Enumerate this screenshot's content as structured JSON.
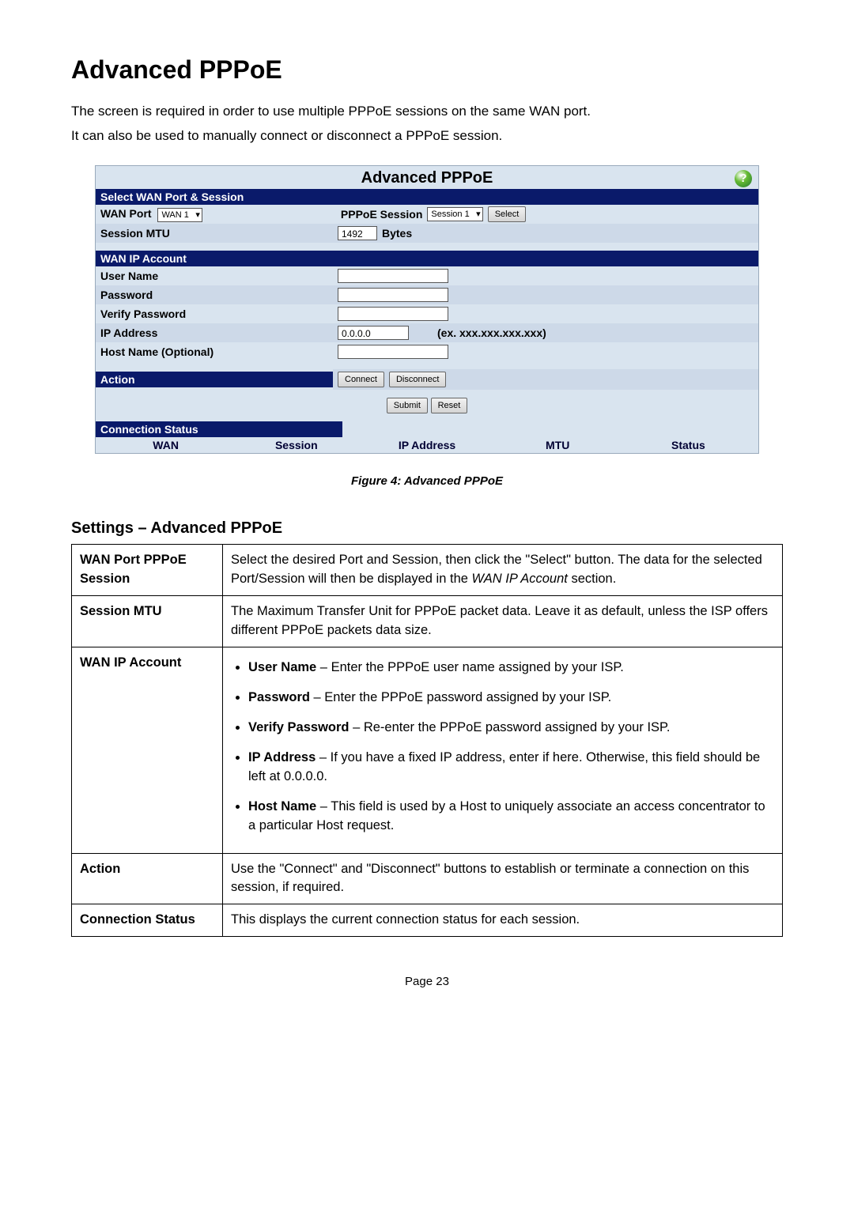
{
  "heading": "Advanced PPPoE",
  "intro_line_1": "The screen is required in order to use multiple PPPoE sessions on the same WAN port.",
  "intro_line_2": "It can also be used to manually connect or disconnect a PPPoE session.",
  "screenshot": {
    "title": "Advanced PPPoE",
    "help_glyph": "?",
    "section_select": "Select WAN Port & Session",
    "row_wan_port_label": "WAN Port",
    "row_wan_port_select": "WAN 1",
    "row_pppoe_session_label": "PPPoE Session",
    "row_pppoe_session_select": "Session 1",
    "row_select_button": "Select",
    "row_session_mtu_label": "Session MTU",
    "row_session_mtu_value": "1492",
    "row_session_mtu_unit": "Bytes",
    "section_wan_ip": "WAN IP Account",
    "row_username_label": "User Name",
    "row_password_label": "Password",
    "row_verify_label": "Verify Password",
    "row_ip_label": "IP Address",
    "row_ip_value": "0.0.0.0",
    "row_ip_hint": "(ex. xxx.xxx.xxx.xxx)",
    "row_hostname_label": "Host Name (Optional)",
    "section_action": "Action",
    "btn_connect": "Connect",
    "btn_disconnect": "Disconnect",
    "btn_submit": "Submit",
    "btn_reset": "Reset",
    "section_conn_status": "Connection Status",
    "col_wan": "WAN",
    "col_session": "Session",
    "col_ip": "IP Address",
    "col_mtu": "MTU",
    "col_status": "Status"
  },
  "figure_caption": "Figure 4: Advanced PPPoE",
  "settings_heading": "Settings – Advanced PPPoE",
  "settings": {
    "row1_label": "WAN Port PPPoE Session",
    "row1_text": "Select the desired Port and Session, then click the \"Select\" button. The data for the selected Port/Session will then be displayed in the WAN IP Account section.",
    "row2_label": "Session MTU",
    "row2_text": "The Maximum Transfer Unit for PPPoE packet data. Leave it as default, unless the ISP offers different PPPoE packets data size.",
    "row3_label": "WAN IP Account",
    "row3_b1_strong": "User Name",
    "row3_b1_text": " – Enter the PPPoE user name assigned by your ISP.",
    "row3_b2_strong": "Password",
    "row3_b2_text": " – Enter the PPPoE password assigned by your ISP.",
    "row3_b3_strong": "Verify Password",
    "row3_b3_text": " – Re-enter the PPPoE password assigned by your ISP.",
    "row3_b4_strong": "IP Address",
    "row3_b4_text": " – If you have a fixed IP address, enter if here. Otherwise, this field should be left at 0.0.0.0.",
    "row3_b5_strong": "Host Name",
    "row3_b5_text": " – This field is used by a Host to uniquely associate an access concentrator to a particular Host request.",
    "row4_label": "Action",
    "row4_text": "Use the \"Connect\" and \"Disconnect\" buttons to establish or terminate a connection on this session, if required.",
    "row5_label": "Connection Status",
    "row5_text": "This displays the current connection status for each session."
  },
  "footer": "Page 23"
}
